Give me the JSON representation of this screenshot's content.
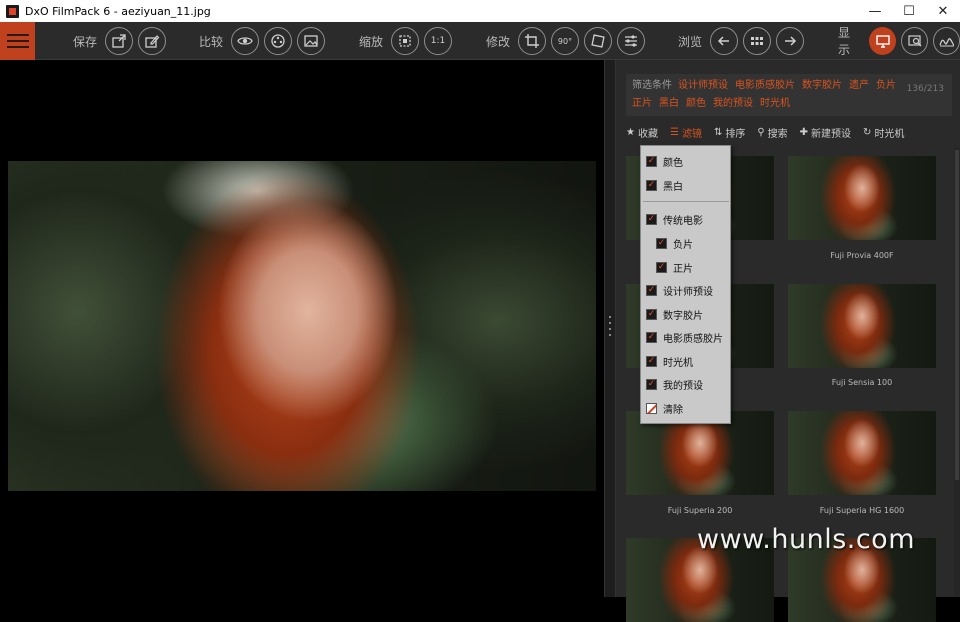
{
  "window": {
    "title": "DxO FilmPack 6 - aeziyuan_11.jpg",
    "minimize": "—",
    "maximize": "☐",
    "close": "✕"
  },
  "toolbar": {
    "save_label": "保存",
    "compare_label": "比较",
    "zoom_label": "缩放",
    "zoom_1to1": "1:1",
    "edit_label": "修改",
    "rotate_90": "90°",
    "browse_label": "浏览",
    "display_label": "显示",
    "accent_color": "#c0411e"
  },
  "filterbar": {
    "label": "筛选条件",
    "tags": [
      "设计师预设",
      "电影质感胶片",
      "数字胶片",
      "遗产",
      "负片",
      "正片",
      "黑白",
      "颜色",
      "我的预设",
      "时光机"
    ],
    "count": "136/213"
  },
  "actions": [
    {
      "icon": "★",
      "label": "收藏"
    },
    {
      "icon": "☰",
      "label": "滤镜"
    },
    {
      "icon": "⇅",
      "label": "排序"
    },
    {
      "icon": "⚲",
      "label": "搜索"
    },
    {
      "icon": "✚",
      "label": "新建预设"
    },
    {
      "icon": "↻",
      "label": "时光机"
    }
  ],
  "filter_menu": {
    "items": [
      {
        "label": "颜色",
        "checked": true
      },
      {
        "label": "黑白",
        "checked": true
      },
      {
        "label": "传统电影",
        "checked": true
      },
      {
        "label": "负片",
        "checked": true
      },
      {
        "label": "正片",
        "checked": true
      },
      {
        "label": "设计师预设",
        "checked": true
      },
      {
        "label": "数字胶片",
        "checked": true
      },
      {
        "label": "电影质感胶片",
        "checked": true
      },
      {
        "label": "时光机",
        "checked": true
      },
      {
        "label": "我的预设",
        "checked": true
      }
    ],
    "clear_label": "清除"
  },
  "thumbnails": [
    {
      "caption": ""
    },
    {
      "caption": "Fuji Provia 400F"
    },
    {
      "caption": ""
    },
    {
      "caption": "Fuji Sensia 100"
    },
    {
      "caption": "Fuji Superia 200"
    },
    {
      "caption": "Fuji Superia HG 1600"
    },
    {
      "caption": ""
    },
    {
      "caption": ""
    }
  ],
  "watermark": "www.hunls.com"
}
